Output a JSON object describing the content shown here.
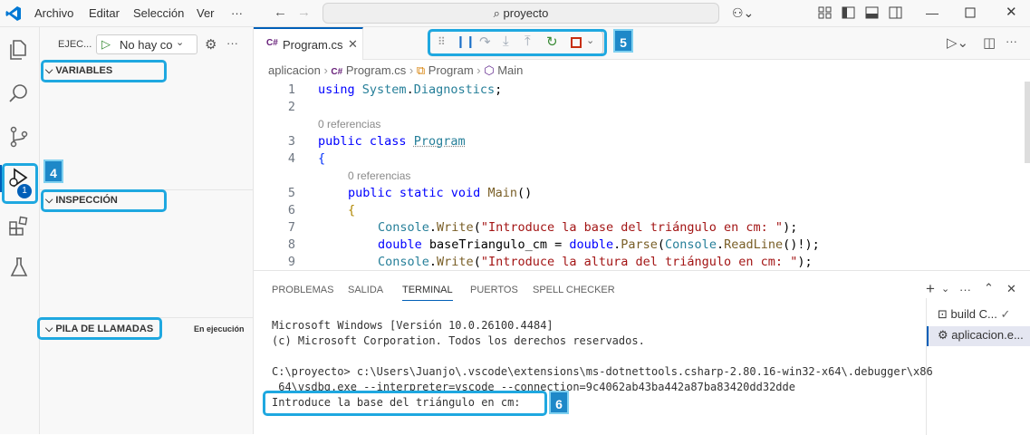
{
  "titlebar": {
    "menus": [
      "Archivo",
      "Editar",
      "Selección",
      "Ver",
      "···"
    ],
    "search": "proyecto"
  },
  "sidebar": {
    "run_label": "EJEC...",
    "config": "No hay coı",
    "sections": {
      "variables": "VARIABLES",
      "watch": "INSPECCIÓN",
      "callstack": "PILA DE LLAMADAS"
    },
    "callstack_status": "En ejecución",
    "debug_count": "1"
  },
  "editor": {
    "tab_label": "Program.cs",
    "breadcrumb": [
      "aplicacion",
      "Program.cs",
      "Program",
      "Main"
    ],
    "references": "0 referencias",
    "lines": [
      {
        "n": "1",
        "text": "using System.Diagnostics;"
      },
      {
        "n": "2",
        "text": ""
      },
      {
        "n": "3",
        "text": "public class Program"
      },
      {
        "n": "4",
        "text": "{"
      },
      {
        "n": "5",
        "text": "public static void Main()"
      },
      {
        "n": "6",
        "text": "{"
      },
      {
        "n": "7",
        "text": "Console.Write(\"Introduce la base del triángulo en cm: \");"
      },
      {
        "n": "8",
        "text": "double baseTriangulo_cm = double.Parse(Console.ReadLine()!);"
      },
      {
        "n": "9",
        "text": "Console.Write(\"Introduce la altura del triángulo en cm: \");"
      }
    ]
  },
  "panel": {
    "tabs": [
      "PROBLEMAS",
      "SALIDA",
      "TERMINAL",
      "PUERTOS",
      "SPELL CHECKER"
    ],
    "terminal_lines": [
      "Microsoft Windows [Versión 10.0.26100.4484]",
      "(c) Microsoft Corporation. Todos los derechos reservados.",
      "",
      "C:\\proyecto> c:\\Users\\Juanjo\\.vscode\\extensions\\ms-dotnettools.csharp-2.80.16-win32-x64\\.debugger\\x86",
      "_64\\vsdbg.exe --interpreter=vscode --connection=9c4062ab43ba442a87ba83420dd32dde",
      "Introduce la base del triángulo en cm: "
    ],
    "term_list": [
      "build C...",
      "aplicacion.e..."
    ]
  },
  "annotations": {
    "callouts": [
      "4",
      "5",
      "6"
    ]
  },
  "colors": {
    "accent": "#005fb8",
    "highlight": "#1fa8e0",
    "badge": "#1e88c8"
  }
}
